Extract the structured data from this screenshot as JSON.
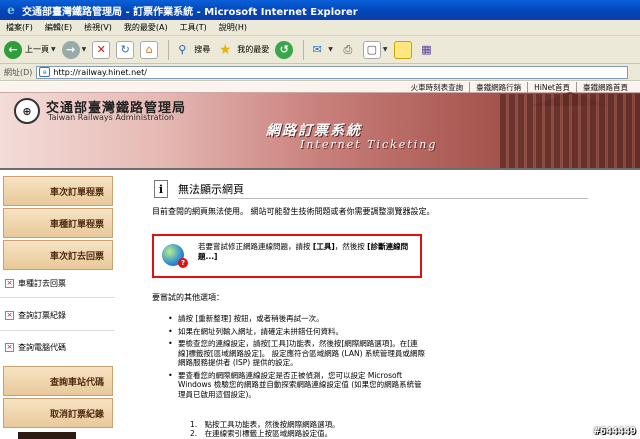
{
  "window": {
    "title": "交通部臺灣鐵路管理局 - 訂票作業系統 - Microsoft Internet Explorer"
  },
  "menu": [
    "檔案(F)",
    "編輯(E)",
    "檢視(V)",
    "我的最愛(A)",
    "工具(T)",
    "說明(H)"
  ],
  "toolbar": {
    "back_label": "上一頁",
    "search_label": "搜尋",
    "favorites_label": "我的最愛"
  },
  "address": {
    "label": "網址(D)",
    "url": "http://railway.hinet.net/"
  },
  "topnav": [
    "火車時刻表查詢",
    "臺鐵網路行銷",
    "HiNet首頁",
    "臺鐵網路首頁"
  ],
  "header": {
    "org_name": "交通部臺灣鐵路管理局",
    "org_name_en": "Taiwan Railways Administration",
    "system_title": "網路訂票系統",
    "system_title_en": "Internet Ticketing"
  },
  "sidebar": {
    "buttons": [
      "車次訂單程票",
      "車種訂單程票",
      "車次訂去回票"
    ],
    "links": [
      "車種訂去回票",
      "查詢訂票紀錄",
      "查詢電腦代碼"
    ],
    "buttons_bottom": [
      "查詢車站代碼",
      "取消訂票紀錄"
    ]
  },
  "error": {
    "heading": "無法顯示網頁",
    "intro": "目前查閱的網頁無法使用。 網站可能發生技術問題或者你需要調整瀏覽器設定。",
    "box_pre": "若要嘗試修正網路連線問題，請按 ",
    "box_tools": "[工具]",
    "box_mid": "，然後按 ",
    "box_diag": "[診斷連線問題...]",
    "other_heading": "要嘗試的其他選項：",
    "bullets": [
      "請按 [重新整理] 按鈕，或者稍後再試一次。",
      "如果在網址列輸入網址，請確定未拼錯任何資料。",
      "要檢查您的連線設定，請按[工具]功能表，然後按[網際網路選項]。在[連線]標籤按[區域網路設定]。 設定應符合區域網路 (LAN) 系統管理員或網際網路服務提供者 (ISP) 提供的設定。",
      "要查看您的網際網路連線設定是否正被偵測，您可以設定 Microsoft Windows 檢驗您的網路並自動探索網路連線設定值 (如果您的網路系統管理員已啟用這個設定)。"
    ],
    "steps": [
      "1.　點按工具功能表，然後按網際網路選項。",
      "2.　在連線索引標籤上按區域網路設定值。"
    ]
  },
  "watermark": "#644449"
}
